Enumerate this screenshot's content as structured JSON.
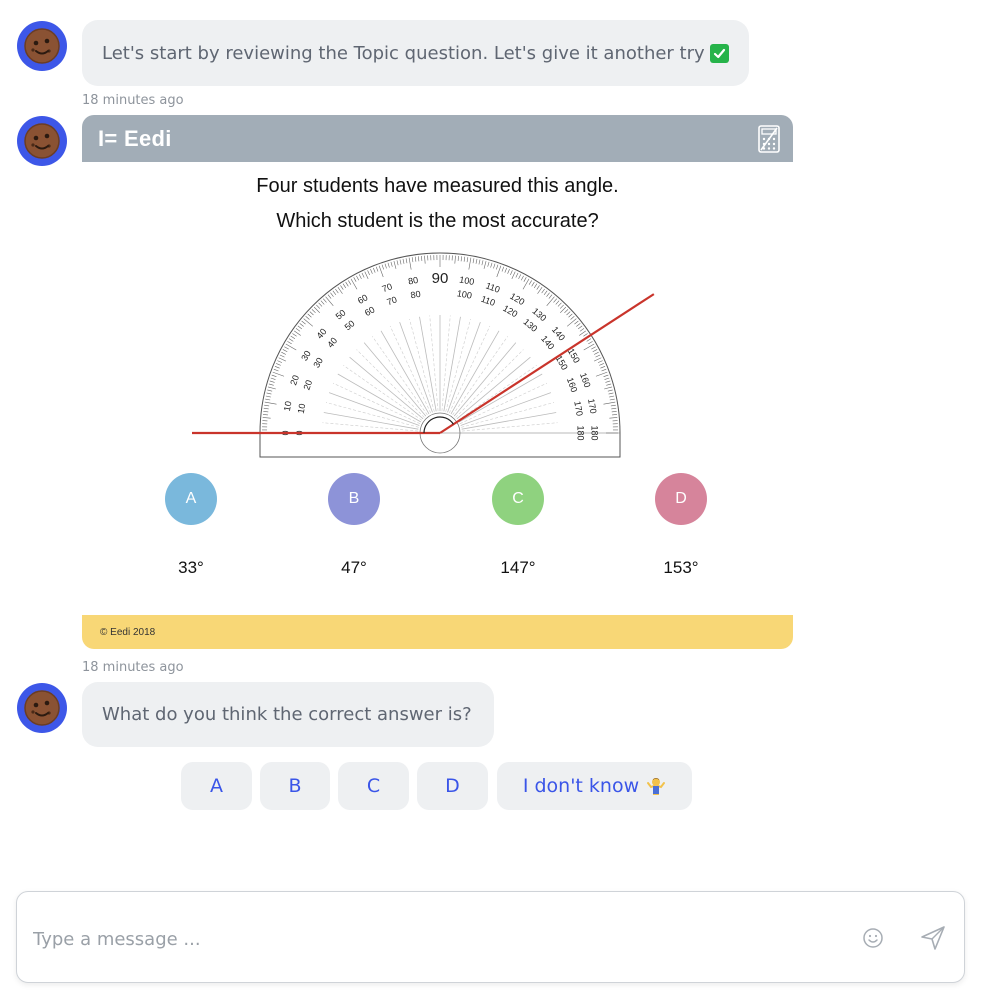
{
  "messages": [
    {
      "text": "Let's start by reviewing the Topic question. Let's give it another try",
      "emoji": "check-mark-icon"
    },
    {
      "timestamp": "18 minutes ago"
    },
    {
      "text": "What do you think the correct answer is?"
    }
  ],
  "question_card": {
    "brand": "I= Eedi",
    "question_line1": "Four students have measured this angle.",
    "question_line2": "Which student is the most accurate?",
    "timestamp": "18 minutes ago",
    "copyright": "© Eedi 2018",
    "options": [
      {
        "letter": "A",
        "value": "33°",
        "color": "#7ab8dc"
      },
      {
        "letter": "B",
        "value": "47°",
        "color": "#8d93d8"
      },
      {
        "letter": "C",
        "value": "147°",
        "color": "#8fd27f"
      },
      {
        "letter": "D",
        "value": "153°",
        "color": "#d6849b"
      }
    ],
    "protractor": {
      "outer_labels": [
        "0",
        "10",
        "20",
        "30",
        "40",
        "50",
        "60",
        "70",
        "80",
        "90",
        "100",
        "110",
        "120",
        "130",
        "140",
        "150",
        "160",
        "170",
        "180"
      ],
      "inner_labels": [
        "180",
        "170",
        "160",
        "150",
        "140",
        "130",
        "120",
        "110",
        "100",
        "80",
        "70",
        "60",
        "50",
        "40",
        "30",
        "20",
        "10",
        "0"
      ],
      "angle_ray_degrees": 33
    }
  },
  "quick_replies": [
    {
      "label": "A"
    },
    {
      "label": "B"
    },
    {
      "label": "C"
    },
    {
      "label": "D"
    },
    {
      "label": "I don't know",
      "emoji": "shrug-icon"
    }
  ],
  "composer": {
    "placeholder": "Type a message ..."
  },
  "colors": {
    "avatar_bg": "#3d57e8",
    "bubble_bg": "#eef0f2",
    "accent": "#3a55e8",
    "card_header": "#a2adb7",
    "card_footer": "#f8d776"
  }
}
